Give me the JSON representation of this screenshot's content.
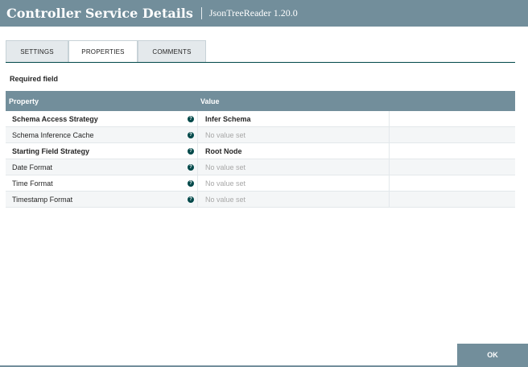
{
  "header": {
    "title": "Controller Service Details",
    "subtitle": "JsonTreeReader 1.20.0"
  },
  "tabs": [
    {
      "label": "SETTINGS",
      "active": false
    },
    {
      "label": "PROPERTIES",
      "active": true
    },
    {
      "label": "COMMENTS",
      "active": false
    }
  ],
  "required_label": "Required field",
  "table": {
    "col_property": "Property",
    "col_value": "Value",
    "rows": [
      {
        "property": "Schema Access Strategy",
        "required": true,
        "value": "Infer Schema"
      },
      {
        "property": "Schema Inference Cache",
        "required": false,
        "value": "No value set"
      },
      {
        "property": "Starting Field Strategy",
        "required": true,
        "value": "Root Node"
      },
      {
        "property": "Date Format",
        "required": false,
        "value": "No value set"
      },
      {
        "property": "Time Format",
        "required": false,
        "value": "No value set"
      },
      {
        "property": "Timestamp Format",
        "required": false,
        "value": "No value set"
      }
    ]
  },
  "help_glyph": "?",
  "ok_label": "OK",
  "colors": {
    "header": "#728e9b",
    "accent": "#004849",
    "unset_text": "#a8a8a8"
  }
}
